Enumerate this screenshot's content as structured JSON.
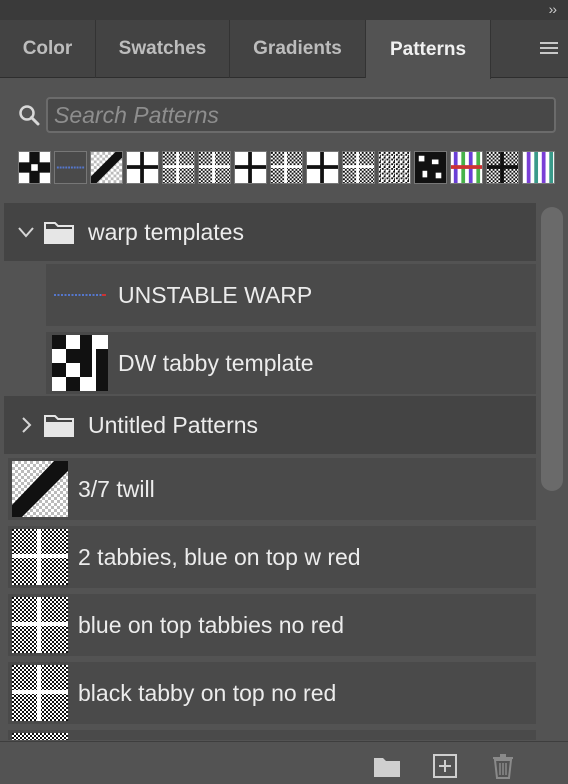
{
  "panel": {
    "collapse_glyph": "››",
    "tabs": [
      {
        "label": "Color"
      },
      {
        "label": "Swatches"
      },
      {
        "label": "Gradients"
      },
      {
        "label": "Patterns",
        "active": true
      }
    ],
    "menu_icon": "hamburger-menu-icon"
  },
  "search": {
    "placeholder": "Search Patterns",
    "icon": "search-icon"
  },
  "recent_patterns": [
    "checker-cross",
    "dotted-line",
    "diagonal-twill",
    "tabby-grid",
    "dense-grid",
    "dense-grid",
    "tabby-grid",
    "dense-grid",
    "tabby-grid",
    "dense-grid",
    "speckle",
    "speckle-dark",
    "color-stripes",
    "tabby-dark",
    "color-stripes"
  ],
  "groups": [
    {
      "label": "warp templates",
      "expanded": true,
      "icon": "folder-icon",
      "items": [
        {
          "label": "UNSTABLE WARP",
          "thumb": "dotted-line"
        },
        {
          "label": "DW tabby template",
          "thumb": "block-pattern"
        }
      ]
    },
    {
      "label": "Untitled Patterns",
      "expanded": false,
      "icon": "folder-icon"
    }
  ],
  "items": [
    {
      "label": "3/7 twill",
      "thumb": "diagonal-twill"
    },
    {
      "label": "2 tabbies, blue on top w red",
      "thumb": "dense-grid"
    },
    {
      "label": "blue on top tabbies no red",
      "thumb": "dense-grid"
    },
    {
      "label": "black tabby on top no red",
      "thumb": "dense-grid"
    }
  ],
  "footer": {
    "icons": [
      "new-group-folder-icon",
      "new-pattern-icon",
      "trash-icon"
    ]
  },
  "colors": {
    "panel_bg": "#535353",
    "tab_bar_bg": "#434343",
    "group_row_bg": "#444444",
    "item_row_bg": "#4a4a4a"
  }
}
